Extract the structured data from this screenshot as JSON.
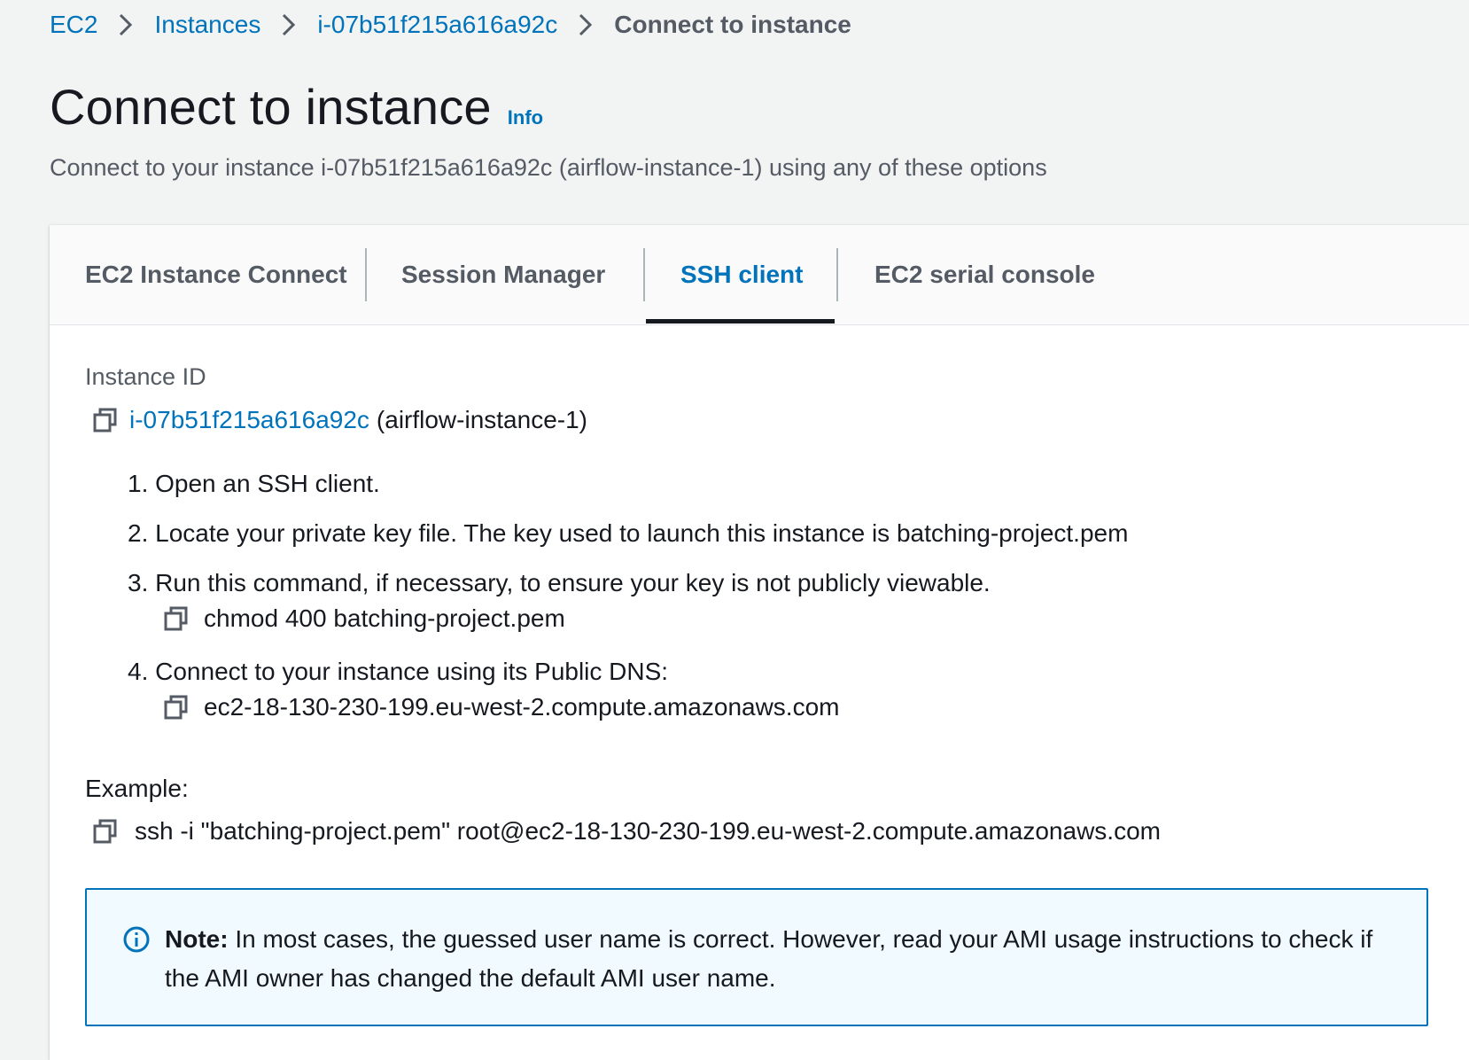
{
  "breadcrumb": {
    "items": [
      "EC2",
      "Instances",
      "i-07b51f215a616a92c"
    ],
    "current": "Connect to instance"
  },
  "header": {
    "title": "Connect to instance",
    "info_label": "Info",
    "subtitle": "Connect to your instance i-07b51f215a616a92c (airflow-instance-1) using any of these options"
  },
  "tabs": [
    {
      "label": "EC2 Instance Connect",
      "active": false
    },
    {
      "label": "Session Manager",
      "active": false
    },
    {
      "label": "SSH client",
      "active": true
    },
    {
      "label": "EC2 serial console",
      "active": false
    }
  ],
  "instance": {
    "label": "Instance ID",
    "id": "i-07b51f215a616a92c",
    "name_suffix": "(airflow-instance-1)"
  },
  "steps": [
    {
      "text": "1. Open an SSH client."
    },
    {
      "text": "2. Locate your private key file. The key used to launch this instance is batching-project.pem"
    },
    {
      "text": "3. Run this command, if necessary, to ensure your key is not publicly viewable.",
      "command": "chmod 400 batching-project.pem"
    },
    {
      "text": "4. Connect to your instance using its Public DNS:",
      "command": "ec2-18-130-230-199.eu-west-2.compute.amazonaws.com"
    }
  ],
  "example": {
    "label": "Example:",
    "command": "ssh -i \"batching-project.pem\" root@ec2-18-130-230-199.eu-west-2.compute.amazonaws.com"
  },
  "note": {
    "prefix": "Note:",
    "text": " In most cases, the guessed user name is correct. However, read your AMI usage instructions to check if the AMI owner has changed the default AMI user name."
  },
  "colors": {
    "link": "#0073bb",
    "text": "#16191f",
    "muted": "#545b64",
    "page_bg": "#f2f3f3",
    "note_bg": "#f1faff"
  },
  "icons": {
    "copy": "copy-icon",
    "chevron": "chevron-right-icon",
    "info": "info-circle-icon"
  }
}
